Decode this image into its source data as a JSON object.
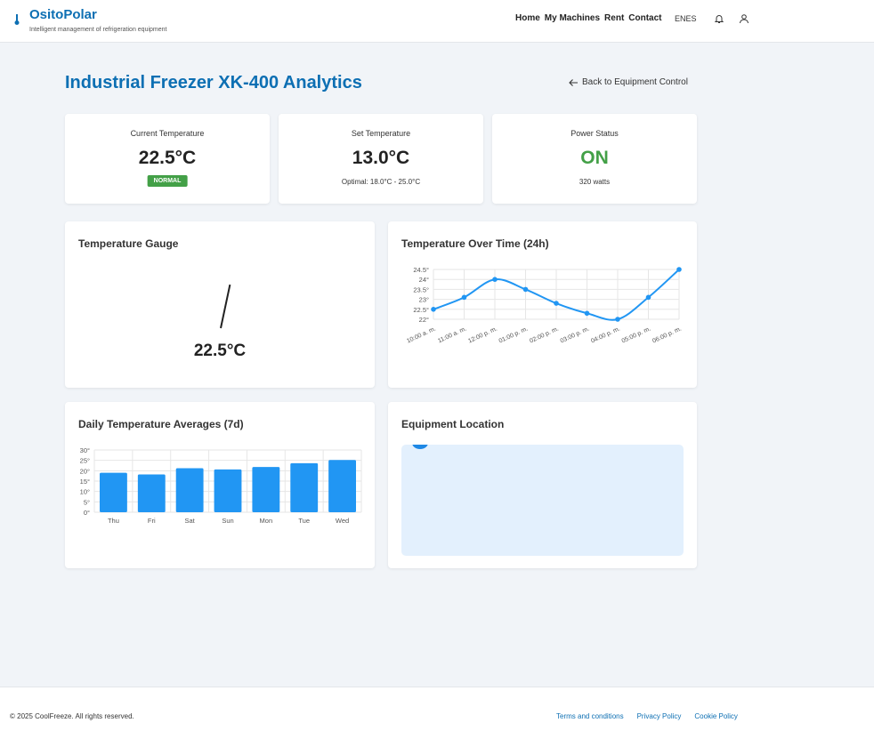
{
  "header": {
    "brand": "OsitoPolar",
    "tagline": "Intelligent management of refrigeration equipment",
    "nav": [
      "Home",
      "My Machines",
      "Rent",
      "Contact"
    ],
    "lang": [
      "EN",
      "ES"
    ],
    "icons": [
      "thermometer-icon",
      "bell-icon",
      "user-icon"
    ]
  },
  "page": {
    "title": "Industrial Freezer XK-400 Analytics",
    "back_label": "Back to Equipment Control"
  },
  "stats": {
    "current": {
      "label": "Current Temperature",
      "value": "22.5°C",
      "badge": "NORMAL"
    },
    "set": {
      "label": "Set Temperature",
      "value": "13.0°C",
      "sub": "Optimal: 18.0°C - 25.0°C"
    },
    "power": {
      "label": "Power Status",
      "value": "ON",
      "sub": "320 watts"
    }
  },
  "gauge": {
    "title": "Temperature Gauge",
    "value": "22.5°C"
  },
  "line_panel_title": "Temperature Over Time (24h)",
  "bar_panel_title": "Daily Temperature Averages (7d)",
  "location": {
    "title": "Equipment Location"
  },
  "colors": {
    "accent": "#0d6fb3",
    "chart": "#2196f3",
    "on": "#43a047",
    "map_bg": "#e3f0fd"
  },
  "chart_data": [
    {
      "type": "line",
      "title": "Temperature Over Time (24h)",
      "x": [
        "10:00 a. m.",
        "11:00 a. m.",
        "12:00 p. m.",
        "01:00 p. m.",
        "02:00 p. m.",
        "03:00 p. m.",
        "04:00 p. m.",
        "05:00 p. m.",
        "06:00 p. m."
      ],
      "y": [
        22.5,
        23.1,
        24.0,
        23.5,
        22.8,
        22.3,
        22.0,
        23.1,
        24.5
      ],
      "y_ticks": [
        "22°",
        "22.5°",
        "23°",
        "23.5°",
        "24°",
        "24.5°"
      ],
      "ylim": [
        22,
        24.5
      ],
      "grid": true
    },
    {
      "type": "bar",
      "title": "Daily Temperature Averages (7d)",
      "categories": [
        "Thu",
        "Fri",
        "Sat",
        "Sun",
        "Mon",
        "Tue",
        "Wed"
      ],
      "values": [
        19,
        18.2,
        21.2,
        20.6,
        21.8,
        23.6,
        25.2
      ],
      "y_ticks": [
        "0°",
        "5°",
        "10°",
        "15°",
        "20°",
        "25°",
        "30°"
      ],
      "ylim": [
        0,
        30
      ],
      "grid": true
    }
  ],
  "footer": {
    "copyright": "© 2025 CoolFreeze. All rights reserved.",
    "links": [
      "Terms and conditions",
      "Privacy Policy",
      "Cookie Policy"
    ]
  }
}
